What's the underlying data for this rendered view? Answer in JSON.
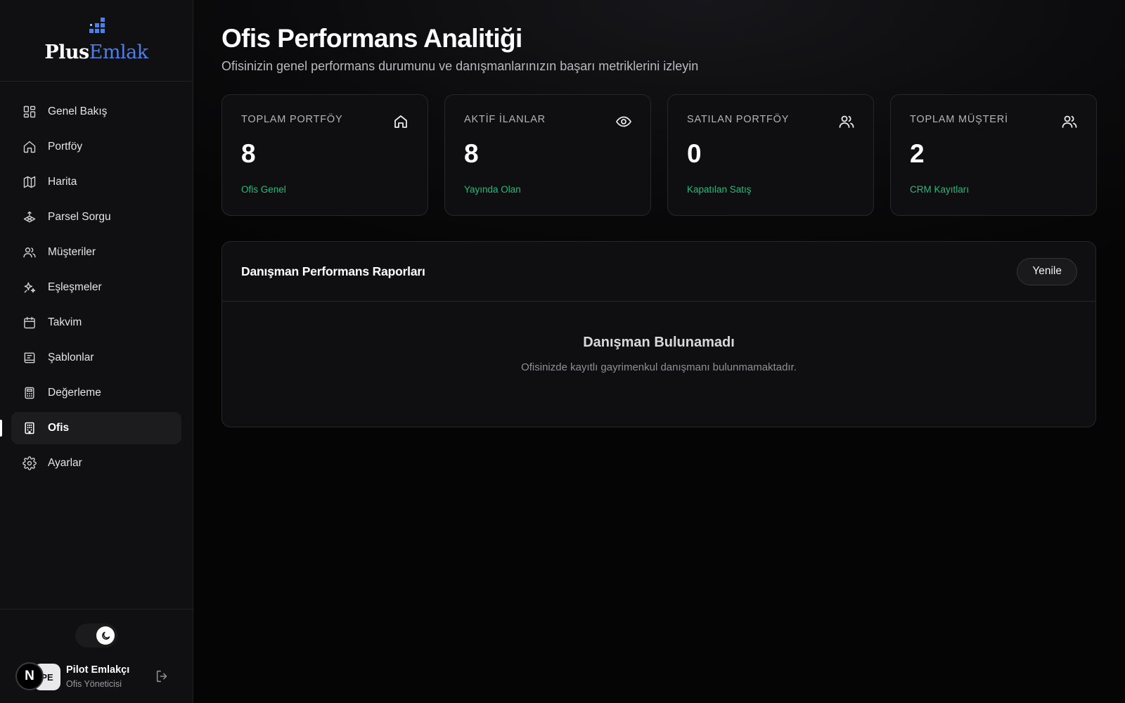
{
  "brand": {
    "name_part1": "Plus",
    "name_part2": "Emlak"
  },
  "sidebar": {
    "items": [
      {
        "label": "Genel Bakış",
        "icon": "dashboard-icon"
      },
      {
        "label": "Portföy",
        "icon": "home-icon"
      },
      {
        "label": "Harita",
        "icon": "map-icon"
      },
      {
        "label": "Parsel Sorgu",
        "icon": "parcel-icon"
      },
      {
        "label": "Müşteriler",
        "icon": "users-icon"
      },
      {
        "label": "Eşleşmeler",
        "icon": "sparkles-icon"
      },
      {
        "label": "Takvim",
        "icon": "calendar-icon"
      },
      {
        "label": "Şablonlar",
        "icon": "template-icon"
      },
      {
        "label": "Değerleme",
        "icon": "calculator-icon"
      },
      {
        "label": "Ofis",
        "icon": "building-icon",
        "active": true
      },
      {
        "label": "Ayarlar",
        "icon": "settings-icon"
      }
    ]
  },
  "user": {
    "initials": "PE",
    "name": "Pilot Emlakçı",
    "role": "Ofis Yöneticisi",
    "badge": "N"
  },
  "header": {
    "title": "Ofis Performans Analitiği",
    "subtitle": "Ofisinizin genel performans durumunu ve danışmanlarınızın başarı metriklerini izleyin"
  },
  "stats": [
    {
      "label": "TOPLAM PORTFÖY",
      "value": "8",
      "sub": "Ofis Genel",
      "icon": "home-icon"
    },
    {
      "label": "AKTİF İLANLAR",
      "value": "8",
      "sub": "Yayında Olan",
      "icon": "eye-icon"
    },
    {
      "label": "SATILAN PORTFÖY",
      "value": "0",
      "sub": "Kapatılan Satış",
      "icon": "users-icon"
    },
    {
      "label": "TOPLAM MÜŞTERİ",
      "value": "2",
      "sub": "CRM Kayıtları",
      "icon": "users-icon"
    }
  ],
  "panel": {
    "title": "Danışman Performans Raporları",
    "refresh_label": "Yenile",
    "empty_title": "Danışman Bulunamadı",
    "empty_desc": "Ofisinizde kayıtlı gayrimenkul danışmanı bulunmamaktadır."
  },
  "colors": {
    "accent_brand": "#4d7fe8",
    "positive": "#1fbf7a",
    "background": "#070708",
    "sidebar": "#101012"
  }
}
